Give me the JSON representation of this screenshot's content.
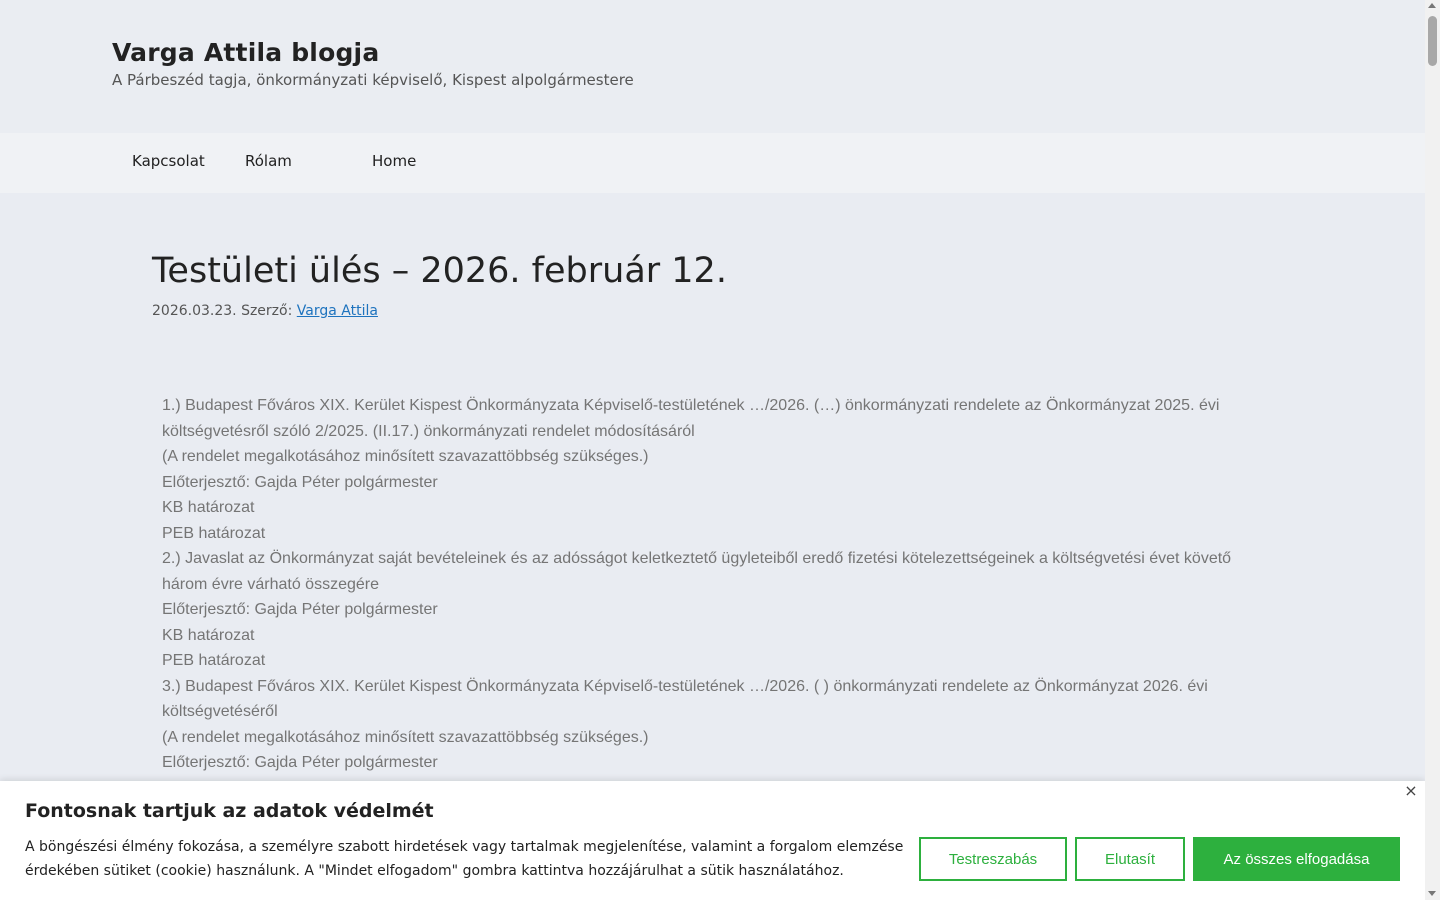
{
  "header": {
    "site_title": "Varga Attila blogja",
    "site_description": "A Párbeszéd tagja, önkormányzati képviselő, Kispest alpolgármestere"
  },
  "nav": {
    "items": [
      {
        "label": "Kapcsolat"
      },
      {
        "label": "Rólam"
      },
      {
        "label": "Home"
      }
    ]
  },
  "post": {
    "title": "Testületi ülés – 2026. február 12.",
    "date": "2026.03.23.",
    "author_prefix": "Szerző:",
    "author": "Varga Attila",
    "paragraphs": [
      "1.) Budapest Főváros XIX. Kerület Kispest Önkormányzata Képviselő-testületének …/2026. (…) önkormányzati rendelete az Önkormányzat 2025. évi költségvetésről szóló 2/2025. (II.17.) önkormányzati rendelet módosításáról",
      "(A rendelet megalkotásához minősített szavazattöbbség szükséges.)",
      "Előterjesztő: Gajda Péter polgármester",
      "KB határozat",
      "PEB határozat",
      "2.) Javaslat az Önkormányzat saját bevételeinek és az adósságot keletkeztető ügyleteiből eredő fizetési kötelezettségeinek a költségvetési évet követő három évre várható összegére",
      "Előterjesztő: Gajda Péter polgármester",
      "KB határozat",
      "PEB határozat",
      "3.) Budapest Főváros XIX. Kerület Kispest Önkormányzata Képviselő-testületének …/2026. ( ) önkormányzati rendelete az Önkormányzat 2026. évi költségvetéséről",
      "(A rendelet megalkotásához minősített szavazattöbbség szükséges.)",
      "Előterjesztő: Gajda Péter polgármester"
    ]
  },
  "cookie_banner": {
    "title": "Fontosnak tartjuk az adatok védelmét",
    "text": "A böngészési élmény fokozása, a személyre szabott hirdetések vagy tartalmak megjelenítése, valamint a forgalom elemzése érdekében sütiket (cookie) használunk. A \"Mindet elfogadom\" gombra kattintva hozzájárulhat a sütik használatához.",
    "close_symbol": "×",
    "customize_label": "Testreszabás",
    "reject_label": "Elutasít",
    "accept_label": "Az összes elfogadása",
    "accent_color": "#2db03e"
  }
}
